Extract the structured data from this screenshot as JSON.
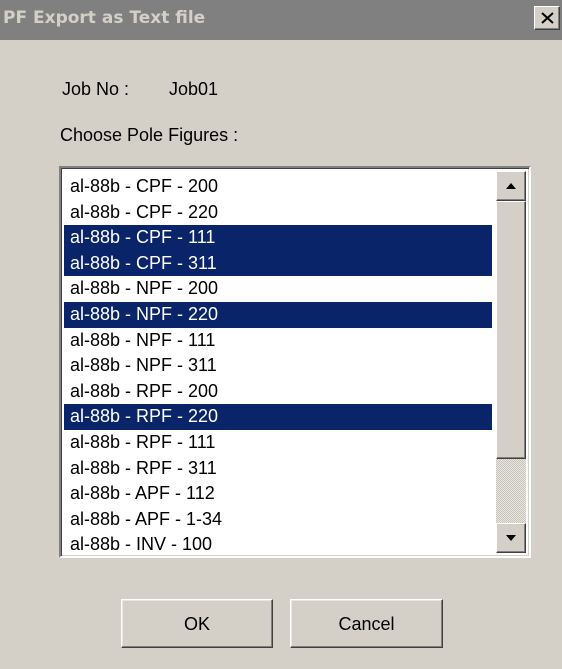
{
  "window": {
    "title": "PF Export as Text file"
  },
  "job": {
    "label": "Job No :",
    "value": "Job01"
  },
  "choose_label": "Choose Pole Figures :",
  "pole_figures": [
    {
      "label": "al-88b - CPF - 200",
      "selected": false
    },
    {
      "label": "al-88b - CPF - 220",
      "selected": false
    },
    {
      "label": "al-88b - CPF - 111",
      "selected": true
    },
    {
      "label": "al-88b - CPF - 311",
      "selected": true
    },
    {
      "label": "al-88b - NPF - 200",
      "selected": false
    },
    {
      "label": "al-88b - NPF - 220",
      "selected": true
    },
    {
      "label": "al-88b - NPF - 111",
      "selected": false
    },
    {
      "label": "al-88b - NPF - 311",
      "selected": false
    },
    {
      "label": "al-88b - RPF - 200",
      "selected": false
    },
    {
      "label": "al-88b - RPF - 220",
      "selected": true
    },
    {
      "label": "al-88b - RPF - 111",
      "selected": false
    },
    {
      "label": "al-88b - RPF - 311",
      "selected": false
    },
    {
      "label": "al-88b - APF - 112",
      "selected": false
    },
    {
      "label": "al-88b - APF - 1-34",
      "selected": false
    },
    {
      "label": "al-88b - INV - 100",
      "selected": false
    }
  ],
  "buttons": {
    "ok": "OK",
    "cancel": "Cancel"
  },
  "icons": {
    "close": "close-icon",
    "scroll_up": "arrow-up-icon",
    "scroll_down": "arrow-down-icon"
  },
  "colors": {
    "selection": "#0a246a",
    "dialog_face": "#d4d0c8",
    "titlebar_inactive": "#808080"
  }
}
